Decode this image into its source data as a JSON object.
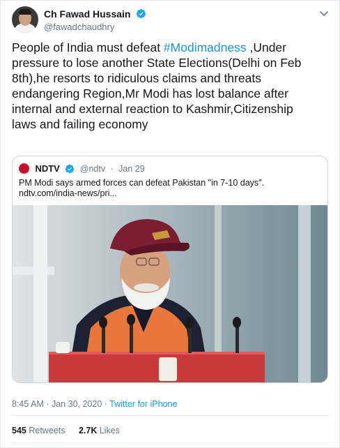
{
  "author": {
    "display_name": "Ch Fawad Hussain",
    "handle": "@fawadchaudhry",
    "avatar_icon": "profile-photo",
    "verified_icon": "verified-badge-icon"
  },
  "menu_icon": "chevron-down-icon",
  "tweet": {
    "text_before": "People of India must defeat ",
    "hashtag": "#Modimadness",
    "text_after": " ,Under pressure to lose another State Elections(Delhi on Feb 8th),he resorts to ridiculous claims and threats endangering Region,Mr Modi has lost balance after internal and external reaction to Kashmir,Citizenship laws and failing economy"
  },
  "quoted_tweet": {
    "name": "NDTV",
    "handle": "@ndtv",
    "separator": "·",
    "date": "Jan 29",
    "text": "PM Modi says armed forces can defeat Pakistan \"in 7-10 days\".",
    "link": "ndtv.com/india-news/pri...",
    "image_alt": "photo-of-speaker-at-podium"
  },
  "footer": {
    "time": "8:45 AM",
    "separator": " · ",
    "date": "Jan 30, 2020",
    "source": "Twitter for iPhone"
  },
  "stats": {
    "retweets_count": "545",
    "retweets_label": "Retweets",
    "likes_count": "2.7K",
    "likes_label": "Likes"
  },
  "colors": {
    "link_blue": "#1b95e0",
    "verified_blue": "#1da1f2",
    "text_primary": "#14171a",
    "text_secondary": "#657786",
    "ndtv_red": "#c8102e"
  }
}
